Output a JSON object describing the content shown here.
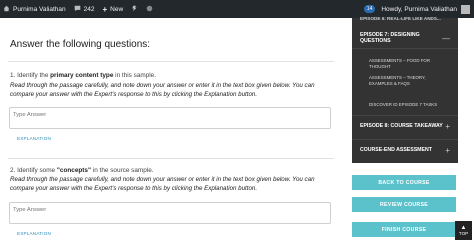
{
  "adminbar": {
    "site_name": "Purnima Valiathan",
    "comments_count": "242",
    "new_label": "New",
    "notifications": "14",
    "howdy": "Howdy, Purnima Valiathan"
  },
  "main": {
    "title": "Answer the following questions:",
    "questions": [
      {
        "prefix": "1. Identify the ",
        "bold": "primary content type",
        "suffix": " in this sample.",
        "instructions": "Read through the passage carefully, and note down your answer or enter it in the text box given below. You can compare your answer with the Expert's response to this by clicking the Explanation button.",
        "placeholder": "Type Answer",
        "explanation_label": "EXPLANATION"
      },
      {
        "prefix": "2. Identify some ",
        "bold": "\"concepts\"",
        "suffix": " in the source sample.",
        "instructions": "Read through the passage carefully, and note down your answer or enter it in the text box given below. You can compare your answer with the Expert's response to this by clicking the Explanation button.",
        "placeholder": "Type Answer",
        "explanation_label": "EXPLANATION"
      }
    ]
  },
  "sidebar": {
    "top_cut_label": "EPISODE 6: REAL-LIFE LIKE ANDS...",
    "sections": [
      {
        "label": "EPISODE 7: DESIGNING QUESTIONS",
        "toggle": "—",
        "lessons": [
          "ASSESSMENTS – FOOD FOR THOUGHT",
          "ASSESSMENTS – THEORY, EXAMPLES & FAQS",
          "DISCOVER ID EPISODE 7 TASKS"
        ]
      },
      {
        "label": "EPISODE 8: COURSE TAKEAWAY",
        "toggle": "+"
      },
      {
        "label": "COURSE-END ASSESSMENT",
        "toggle": "+"
      }
    ],
    "buttons": {
      "back": "BACK TO COURSE",
      "review": "REVIEW COURSE",
      "finish": "FINISH COURSE"
    }
  },
  "top_button": {
    "label": "TOP"
  }
}
